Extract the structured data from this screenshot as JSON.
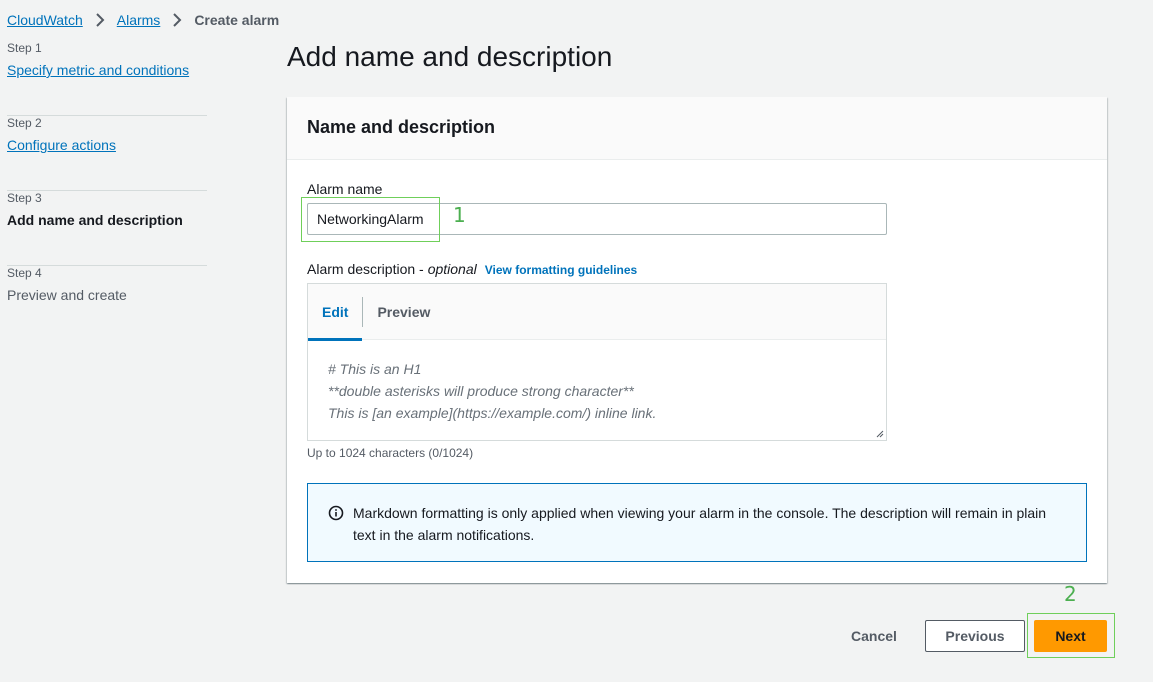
{
  "breadcrumb": {
    "cloudwatch": "CloudWatch",
    "alarms": "Alarms",
    "current": "Create alarm"
  },
  "steps": [
    {
      "num": "Step 1",
      "title": "Specify metric and conditions",
      "state": "link"
    },
    {
      "num": "Step 2",
      "title": "Configure actions",
      "state": "link"
    },
    {
      "num": "Step 3",
      "title": "Add name and description",
      "state": "active"
    },
    {
      "num": "Step 4",
      "title": "Preview and create",
      "state": "disabled"
    }
  ],
  "page": {
    "title": "Add name and description"
  },
  "panel": {
    "header": "Name and description",
    "alarm_name_label": "Alarm name",
    "alarm_name_value": "NetworkingAlarm",
    "desc_label": "Alarm description -",
    "desc_optional": "optional",
    "desc_guide_link": "View formatting guidelines",
    "tabs": {
      "edit": "Edit",
      "preview": "Preview"
    },
    "editor_placeholder": [
      "# This is an H1",
      "**double asterisks will produce strong character**",
      "This is [an example](https://example.com/) inline link."
    ],
    "char_count": "Up to 1024 characters (0/1024)",
    "info_text": "Markdown formatting is only applied when viewing your alarm in the console. The description will remain in plain text in the alarm notifications."
  },
  "footer": {
    "cancel": "Cancel",
    "previous": "Previous",
    "next": "Next"
  },
  "annotations": {
    "marker_1": "1",
    "marker_2": "2"
  },
  "colors": {
    "link": "#0073bb",
    "primary_button": "#ff9900",
    "annotation": "#6fcf5a"
  }
}
